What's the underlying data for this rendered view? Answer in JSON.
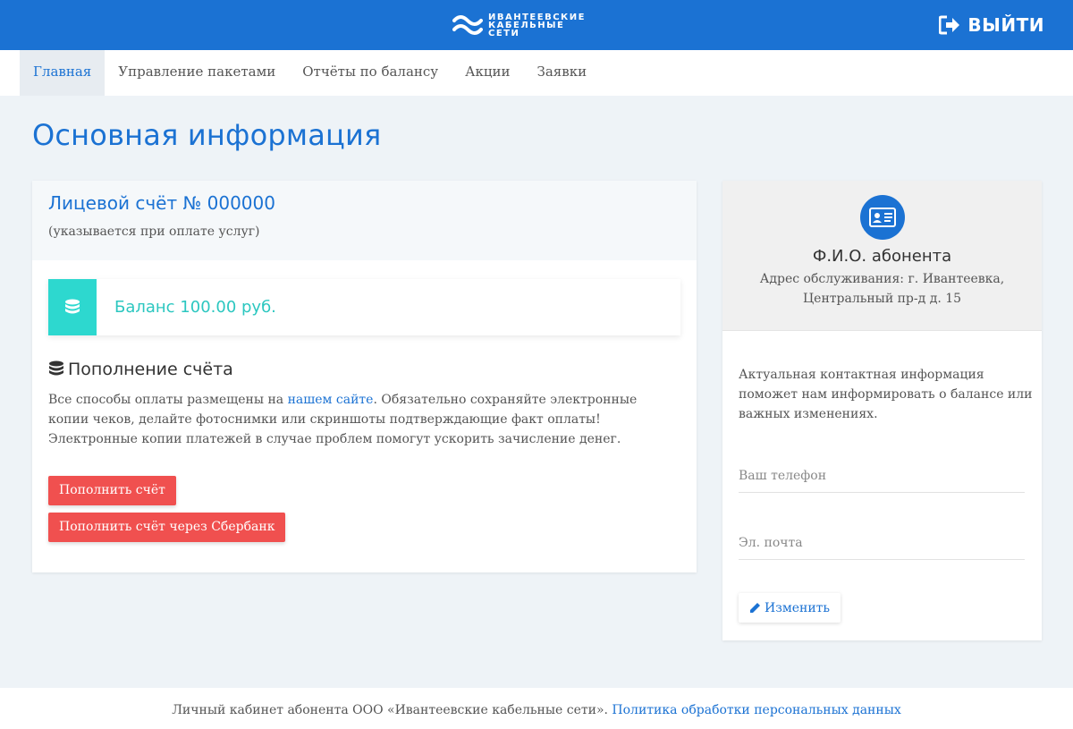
{
  "brand": {
    "logo_lines": [
      "ИВАНТЕЕВСКИЕ",
      "КАБЕЛЬНЫЕ",
      "СЕТИ"
    ],
    "logo_icon": "waves-logo-icon",
    "primary_color": "#1b72d3",
    "accent_color": "#2dd8cf",
    "danger_color": "#f0504f"
  },
  "header": {
    "exit_label": "ВЫЙТИ",
    "exit_icon": "sign-out-icon"
  },
  "nav": {
    "items": [
      {
        "label": "Главная",
        "active": true
      },
      {
        "label": "Управление пакетами",
        "active": false
      },
      {
        "label": "Отчёты по балансу",
        "active": false
      },
      {
        "label": "Акции",
        "active": false
      },
      {
        "label": "Заявки",
        "active": false
      }
    ]
  },
  "main": {
    "title": "Основная информация",
    "account": {
      "title": "Лицевой счёт № 000000",
      "note": "(указывается при оплате услуг)"
    },
    "balance": {
      "icon": "database-icon",
      "text": "Баланс 100.00 руб."
    },
    "topup": {
      "icon": "database-icon",
      "title": "Пополнение счёта",
      "text_before": "Все способы оплаты размещены на ",
      "link_text": "нашем сайте",
      "text_after": ". Обязательно сохраняйте электронные копии чеков, делайте фотоснимки или скриншоты подтверждающие факт оплаты! Электронные копии платежей в случае проблем помогут ускорить зачисление денег.",
      "btn_topup": "Пополнить счёт",
      "btn_sber": "Пополнить счёт через Сбербанк"
    }
  },
  "profile": {
    "avatar_icon": "id-card-icon",
    "name": "Ф.И.О. абонента",
    "address_line1": "Адрес обслуживания: г. Ивантеевка,",
    "address_line2": "Центральный пр-д д. 15",
    "contact_info": "Актуальная контактная информация поможет нам информировать о балансе или важных изменениях.",
    "phone_placeholder": "Ваш телефон",
    "phone_value": "",
    "email_placeholder": "Эл. почта",
    "email_value": "",
    "edit_icon": "pencil-icon",
    "edit_label": "Изменить"
  },
  "footer": {
    "text": "Личный кабинет абонента ООО «Ивантеевские кабельные сети». ",
    "link_text": "Политика обработки персональных данных"
  }
}
